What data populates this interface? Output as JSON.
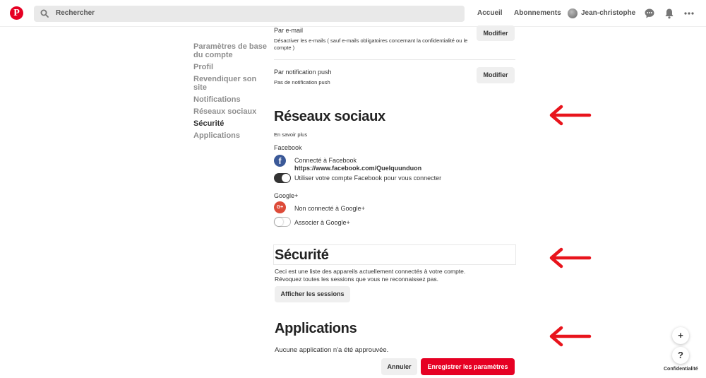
{
  "header": {
    "logo": "P",
    "search_placeholder": "Rechercher",
    "nav": {
      "home": "Accueil",
      "following": "Abonnements",
      "user": "Jean-christophe"
    }
  },
  "sidebar": {
    "items": [
      {
        "label": "Paramètres de base du compte",
        "active": false
      },
      {
        "label": "Profil",
        "active": false
      },
      {
        "label": "Revendiquer son site",
        "active": false
      },
      {
        "label": "Notifications",
        "active": false
      },
      {
        "label": "Réseaux sociaux",
        "active": false
      },
      {
        "label": "Sécurité",
        "active": true
      },
      {
        "label": "Applications",
        "active": false
      }
    ]
  },
  "notifications": {
    "email_label": "Par e-mail",
    "email_desc": "Désactiver les e-mails ( sauf e-mails obligatoires concernant la confidentialité ou le compte )",
    "email_button": "Modifier",
    "push_label": "Par notification push",
    "push_desc": "Pas de notification push",
    "push_button": "Modifier"
  },
  "social": {
    "title": "Réseaux sociaux",
    "learn_more": "En savoir plus",
    "facebook_label": "Facebook",
    "facebook_status": "Connecté à Facebook",
    "facebook_url": "https://www.facebook.com/Quelquunduon",
    "facebook_toggle_label": "Utiliser votre compte Facebook pour vous connecter",
    "facebook_toggle_on": true,
    "google_label": "Google+",
    "google_icon": "G+",
    "google_status": "Non connecté à Google+",
    "google_toggle_label": "Associer à Google+",
    "google_toggle_on": false
  },
  "security": {
    "title": "Sécurité",
    "desc_line1": "Ceci est une liste des appareils actuellement connectés à votre compte.",
    "desc_line2": "Révoquez toutes les sessions que vous ne reconnaissez pas.",
    "sessions_button": "Afficher les sessions"
  },
  "applications": {
    "title": "Applications",
    "desc": "Aucune application n'a été approuvée."
  },
  "footer": {
    "cancel": "Annuler",
    "save": "Enregistrer les paramètres",
    "privacy": "Confidentialité",
    "plus": "+",
    "help": "?"
  },
  "colors": {
    "brand": "#e60023",
    "arrow": "#e8141c",
    "toggle_on": "#333333",
    "facebook": "#3b5998",
    "google": "#dd4b39"
  },
  "icons": [
    "pinterest-logo",
    "search-icon",
    "chat-icon",
    "bell-icon",
    "more-icon",
    "facebook-icon",
    "google-plus-icon",
    "red-arrow"
  ]
}
